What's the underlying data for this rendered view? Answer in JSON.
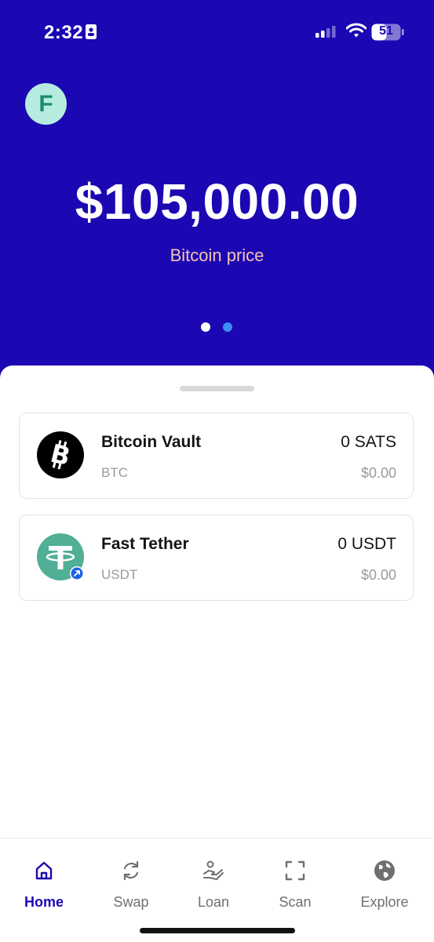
{
  "status_bar": {
    "time": "2:32",
    "battery": "51",
    "icons": [
      "id-card-icon",
      "cellular-signal-icon",
      "wifi-icon",
      "battery-icon"
    ]
  },
  "header": {
    "avatar_initial": "F",
    "price": "$105,000.00",
    "price_label": "Bitcoin price",
    "pager": {
      "pages": 2,
      "active_page": 1
    }
  },
  "assets": [
    {
      "name": "Bitcoin Vault",
      "ticker": "BTC",
      "amount": "0 SATS",
      "fiat": "$0.00",
      "icon": "bitcoin-icon"
    },
    {
      "name": "Fast Tether",
      "ticker": "USDT",
      "amount": "0 USDT",
      "fiat": "$0.00",
      "icon": "tether-icon"
    }
  ],
  "tabs": [
    {
      "label": "Home",
      "icon": "home-icon",
      "active": true
    },
    {
      "label": "Swap",
      "icon": "swap-icon",
      "active": false
    },
    {
      "label": "Loan",
      "icon": "loan-icon",
      "active": false
    },
    {
      "label": "Scan",
      "icon": "scan-icon",
      "active": false
    },
    {
      "label": "Explore",
      "icon": "globe-icon",
      "active": false
    }
  ],
  "colors": {
    "brand": "#1b08b3",
    "price_label": "#f7c2b4",
    "avatar_bg": "#b6ece0",
    "tether": "#50af95",
    "pager_active": "#ffffff",
    "pager_inactive": "#3d8df0"
  }
}
